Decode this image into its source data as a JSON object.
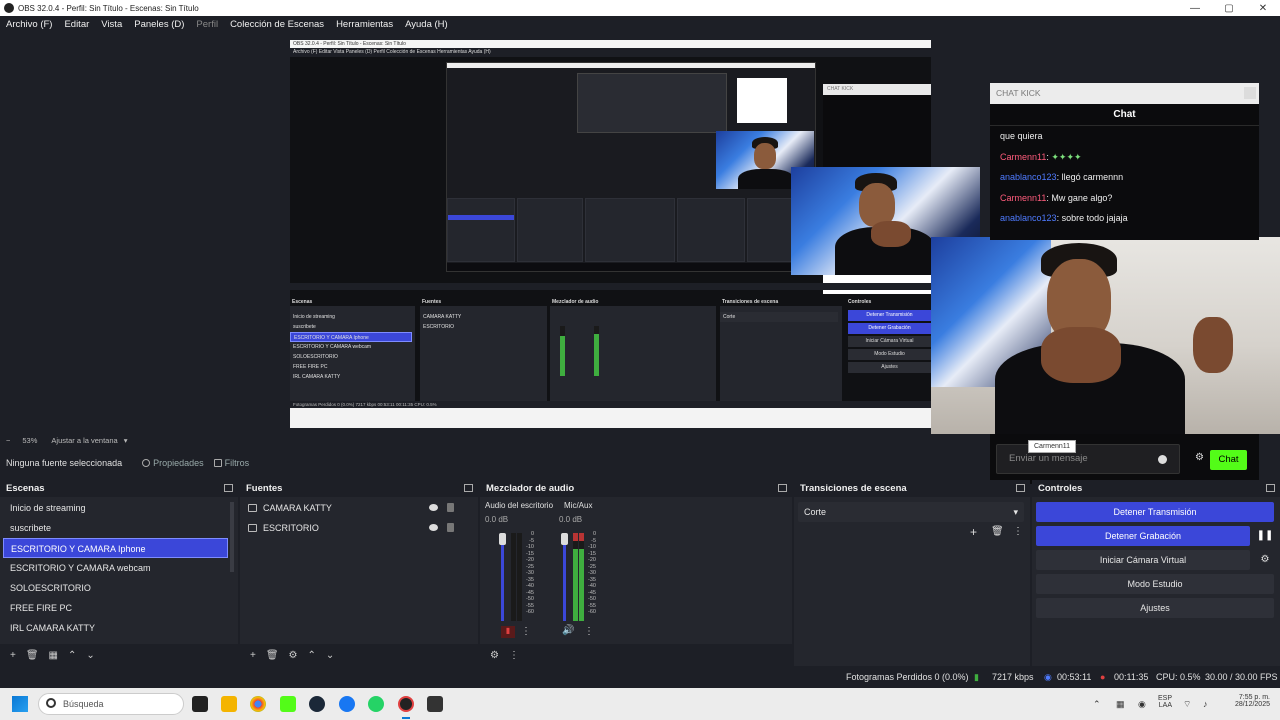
{
  "window": {
    "title": "OBS 32.0.4 - Perfil: Sin Título - Escenas: Sin Título",
    "minimize": "—",
    "maximize": "▢",
    "close": "✕"
  },
  "menu": {
    "items": [
      "Archivo (F)",
      "Editar",
      "Vista",
      "Paneles (D)",
      "Perfil",
      "Colección de Escenas",
      "Herramientas",
      "Ayuda (H)"
    ]
  },
  "preview": {
    "nested_title": "OBS 32.0.4 - Perfil: Sin Título - Escenas: Sin Título",
    "nested_menu": "Archivo (F)   Editar   Vista   Paneles (D)   Perfil   Colección de Escenas   Herramientas   Ayuda (H)",
    "nested_status": "Fotogramas Perdidos 0 (0.0%)   7217 kbps   00:53:11   00:11:35   CPU: 0.5%"
  },
  "chat_overlay": {
    "header": "CHAT KICK",
    "title": "Chat",
    "messages": [
      {
        "user": "",
        "text": "que quiera"
      },
      {
        "user": "Carmenn11",
        "sep": ": ",
        "text": "✦✦✦✦"
      },
      {
        "user": "anablanco123",
        "sep": ": ",
        "text": "llegó carmennn"
      },
      {
        "user": "Carmenn11",
        "sep": ": ",
        "text": "Mw gane algo?"
      },
      {
        "user": "anablanco123",
        "sep": ": ",
        "text": "sobre todo jajaja"
      }
    ],
    "input_placeholder": "Enviar un mensaje",
    "send_button": "Chat",
    "tooltip": "Carmenn11"
  },
  "zoom": {
    "minus": "−",
    "level": "53%",
    "fit": "Ajustar a la ventana"
  },
  "source_toolbar": {
    "no_source": "Ninguna fuente seleccionada",
    "properties": "Propiedades",
    "filters": "Filtros"
  },
  "scenes": {
    "title": "Escenas",
    "items": [
      "Inicio de streaming",
      "suscribete",
      "ESCRITORIO Y CAMARA Iphone",
      "ESCRITORIO Y CAMARA webcam",
      "SOLOESCRITORIO",
      "FREE FIRE PC",
      "IRL CAMARA KATTY"
    ],
    "selected_index": 2
  },
  "sources": {
    "title": "Fuentes",
    "items": [
      "CAMARA KATTY",
      "ESCRITORIO"
    ]
  },
  "mixer": {
    "title": "Mezclador de audio",
    "channels": [
      {
        "name": "Audio del escritorio",
        "db": "0.0 dB"
      },
      {
        "name": "Mic/Aux",
        "db": "0.0 dB"
      }
    ],
    "scale": [
      "0",
      "-5",
      "-10",
      "-15",
      "-20",
      "-25",
      "-30",
      "-35",
      "-40",
      "-45",
      "-50",
      "-55",
      "-60"
    ]
  },
  "transitions": {
    "title": "Transiciones de escena",
    "selected": "Corte"
  },
  "controls": {
    "title": "Controles",
    "buttons": [
      "Detener Transmisión",
      "Detener Grabación",
      "Iniciar Cámara Virtual",
      "Modo Estudio",
      "Ajustes"
    ]
  },
  "status": {
    "dropped": "Fotogramas Perdidos 0 (0.0%)",
    "bitrate": "7217 kbps",
    "stream_time": "00:53:11",
    "rec_time": "00:11:35",
    "cpu": "CPU: 0.5%",
    "fps": "30.00 / 30.00 FPS"
  },
  "taskbar": {
    "search_placeholder": "Búsqueda",
    "lang_top": "ESP",
    "lang_bottom": "LAA",
    "time": "7:55 p. m.",
    "date": "28/12/2025"
  },
  "colors": {
    "accent": "#3b47d9",
    "kick_green": "#53fc18",
    "record_red": "#b83434"
  }
}
